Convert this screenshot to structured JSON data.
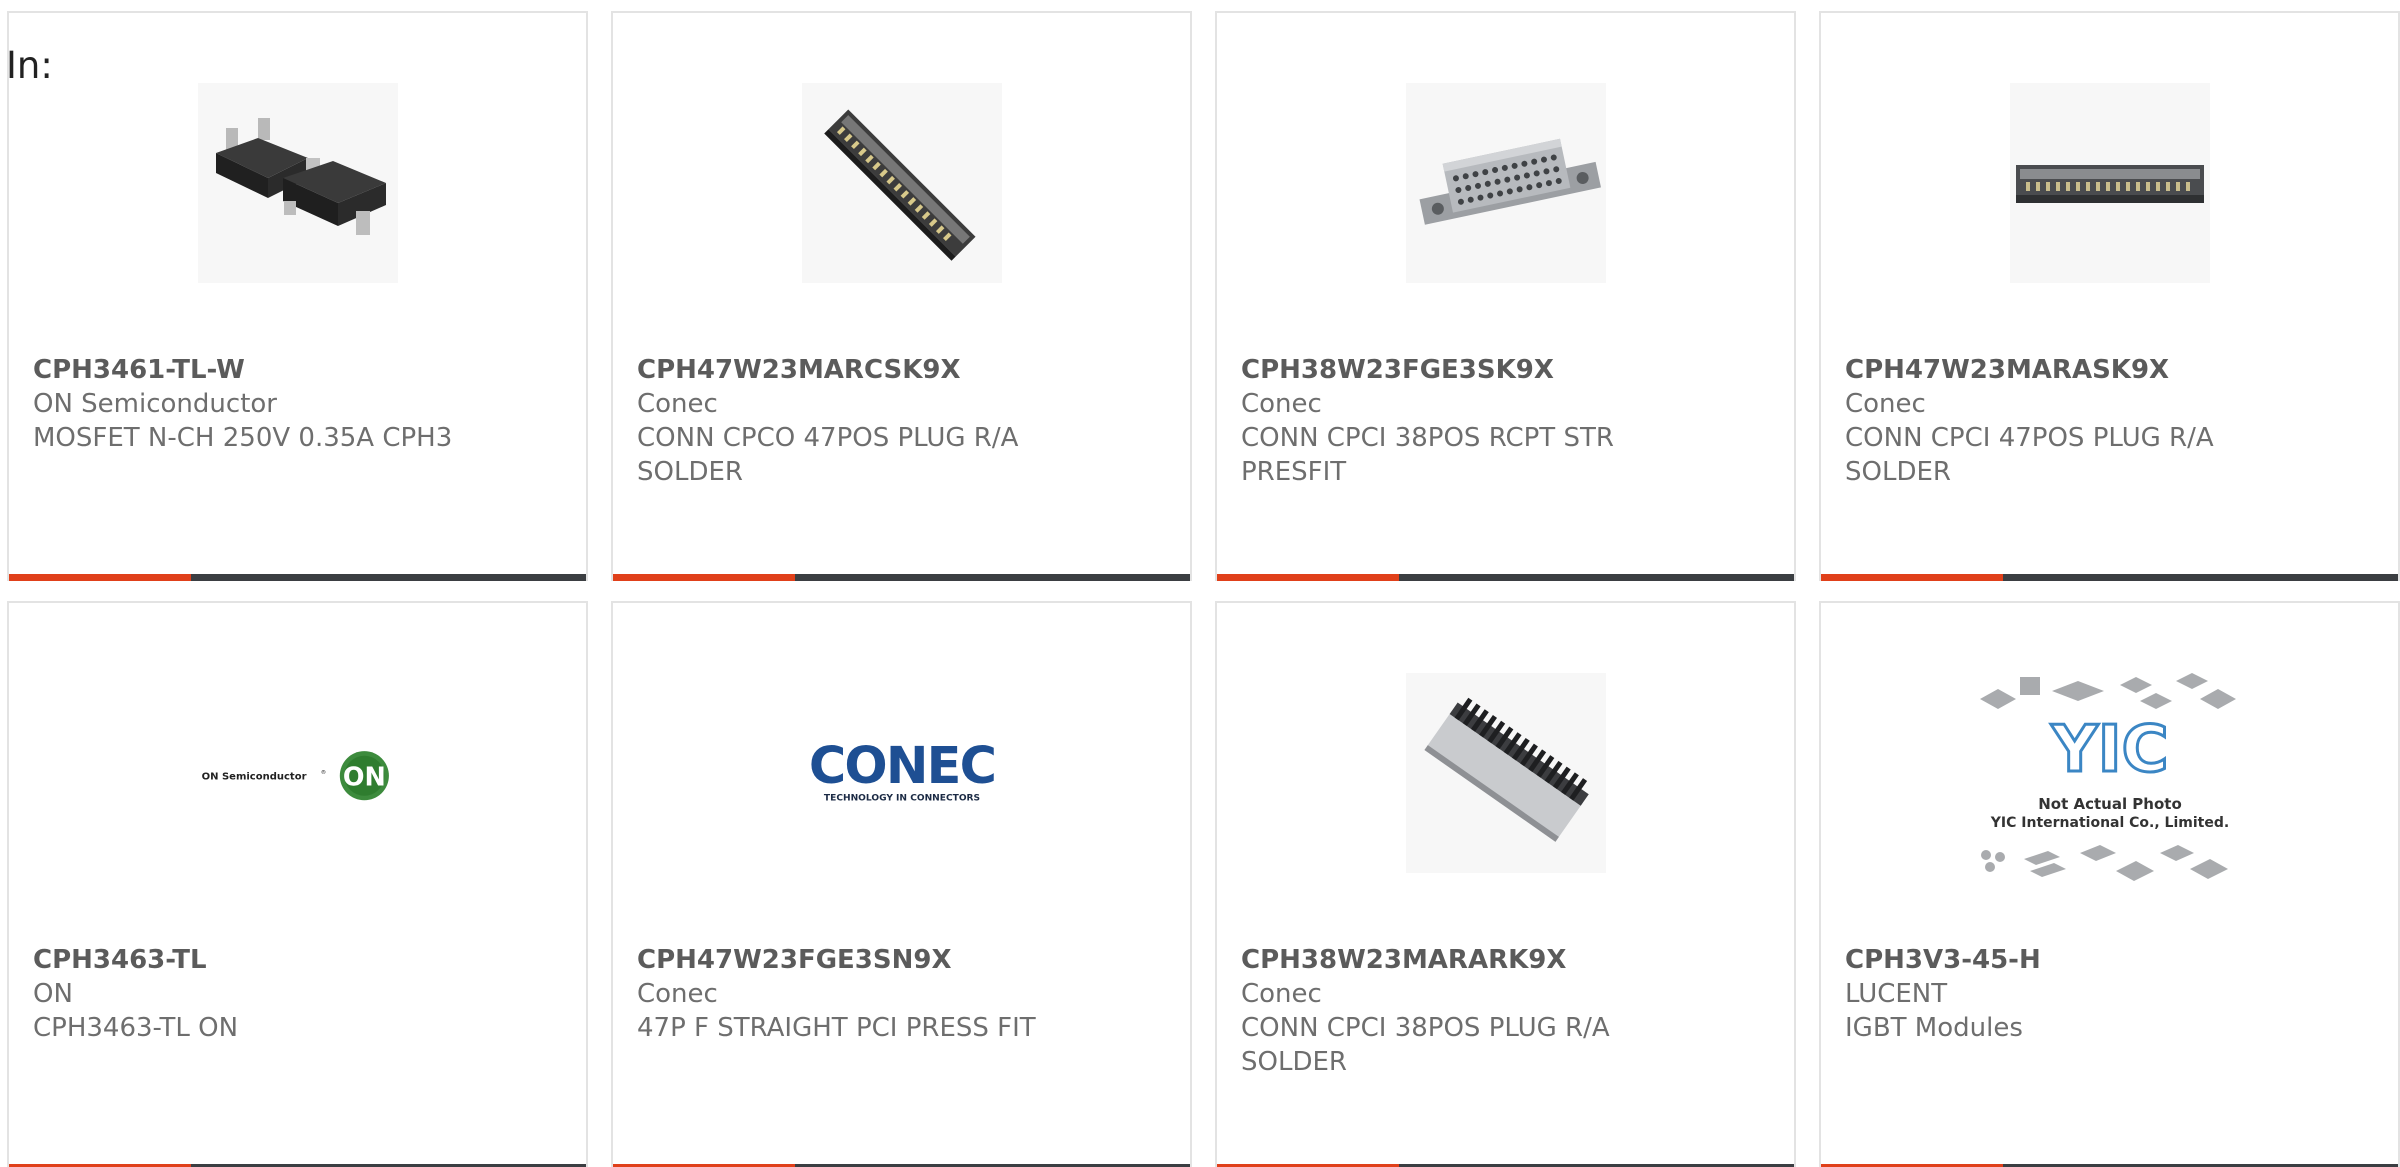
{
  "header": {
    "in_label": "In:"
  },
  "colors": {
    "accent": "#e0401a",
    "bar": "#3b3e42",
    "border": "#e3e3e3",
    "text": "#6e6e6e"
  },
  "products": [
    {
      "part_number": "CPH3461-TL-W",
      "manufacturer": "ON Semiconductor",
      "description": "MOSFET N-CH 250V 0.35A CPH3",
      "image": "mosfet-package-image"
    },
    {
      "part_number": "CPH47W23MARCSK9X",
      "manufacturer": "Conec",
      "description": "CONN CPCO 47POS PLUG R/A SOLDER",
      "image": "right-angle-connector-image"
    },
    {
      "part_number": "CPH38W23FGE3SK9X",
      "manufacturer": "Conec",
      "description": "CONN CPCI 38POS RCPT STR PRESFIT",
      "image": "receptacle-connector-image"
    },
    {
      "part_number": "CPH47W23MARASK9X",
      "manufacturer": "Conec",
      "description": "CONN CPCI 47POS PLUG R/A SOLDER",
      "image": "plug-connector-image"
    },
    {
      "part_number": "CPH3463-TL",
      "manufacturer": "ON",
      "description": "CPH3463-TL ON",
      "image": "on-semiconductor-logo"
    },
    {
      "part_number": "CPH47W23FGE3SN9X",
      "manufacturer": "Conec",
      "description": "47P F STRAIGHT PCI PRESS FIT",
      "image": "conec-logo"
    },
    {
      "part_number": "CPH38W23MARARK9X",
      "manufacturer": "Conec",
      "description": "CONN CPCI 38POS PLUG R/A SOLDER",
      "image": "pin-header-connector-image"
    },
    {
      "part_number": "CPH3V3-45-H",
      "manufacturer": "LUCENT",
      "description": "IGBT Modules",
      "image": "yic-not-actual-photo-image"
    }
  ],
  "logos": {
    "on_semi_text": "ON Semiconductor",
    "on_semi_badge": "ON",
    "conec_word": "CONEC",
    "conec_tagline": "TECHNOLOGY IN CONNECTORS",
    "yic_mark": "YIC",
    "yic_line1": "Not Actual Photo",
    "yic_line2": "YIC International Co., Limited."
  }
}
